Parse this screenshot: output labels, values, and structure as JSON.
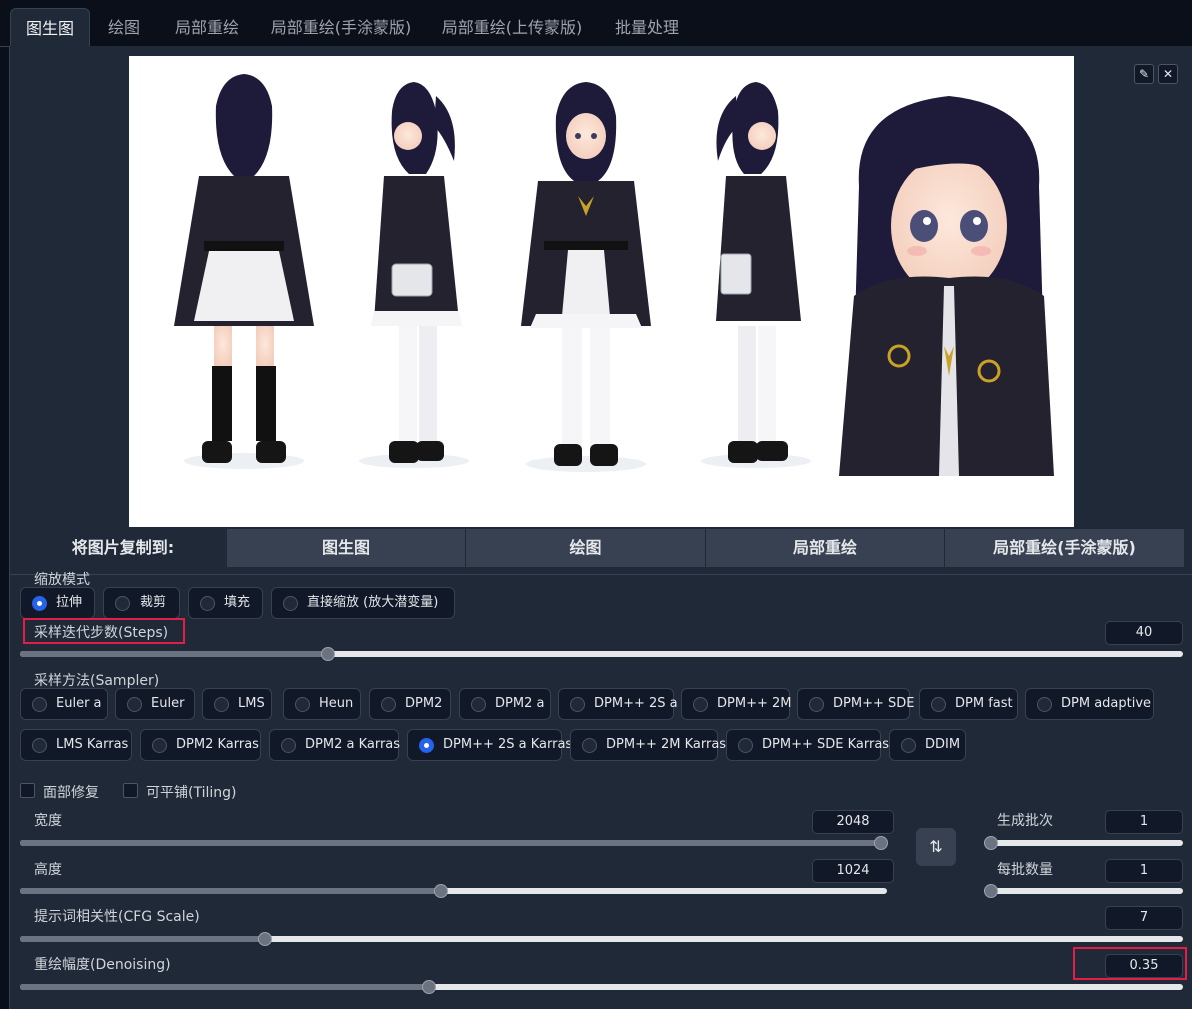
{
  "tabs": [
    "图生图",
    "绘图",
    "局部重绘",
    "局部重绘(手涂蒙版)",
    "局部重绘(上传蒙版)",
    "批量处理"
  ],
  "image_tools": {
    "edit_icon": "pencil-icon",
    "close_icon": "close-icon"
  },
  "copy_to": {
    "label": "将图片复制到:",
    "buttons": [
      "图生图",
      "绘图",
      "局部重绘",
      "局部重绘(手涂蒙版)"
    ]
  },
  "resize_mode": {
    "label": "缩放模式",
    "options": [
      "拉伸",
      "裁剪",
      "填充",
      "直接缩放 (放大潜变量)"
    ],
    "selected": "拉伸"
  },
  "steps": {
    "label": "采样迭代步数(Steps)",
    "value": "40",
    "fraction": 0.26
  },
  "sampler": {
    "label": "采样方法(Sampler)",
    "row1": [
      "Euler a",
      "Euler",
      "LMS",
      "Heun",
      "DPM2",
      "DPM2 a",
      "DPM++ 2S a",
      "DPM++ 2M",
      "DPM++ SDE",
      "DPM fast",
      "DPM adaptive"
    ],
    "row2": [
      "LMS Karras",
      "DPM2 Karras",
      "DPM2 a Karras",
      "DPM++ 2S a Karras",
      "DPM++ 2M Karras",
      "DPM++ SDE Karras",
      "DDIM"
    ],
    "selected": "DPM++ 2S a Karras"
  },
  "checks": {
    "face_restore": "面部修复",
    "tiling": "可平铺(Tiling)"
  },
  "width": {
    "label": "宽度",
    "value": "2048",
    "fraction": 1.0
  },
  "height": {
    "label": "高度",
    "value": "1024",
    "fraction": 0.48
  },
  "batch_count": {
    "label": "生成批次",
    "value": "1",
    "fraction": 0.0
  },
  "batch_size": {
    "label": "每批数量",
    "value": "1",
    "fraction": 0.0
  },
  "cfg": {
    "label": "提示词相关性(CFG Scale)",
    "value": "7",
    "fraction": 0.21
  },
  "denoising": {
    "label": "重绘幅度(Denoising)",
    "value": "0.35",
    "fraction": 0.35
  },
  "swap_icon": "swap-vertical-icon",
  "colors": {
    "accent": "#2563eb",
    "highlight": "#e11d48",
    "panel": "#1f2937",
    "background": "#0b0f19"
  }
}
